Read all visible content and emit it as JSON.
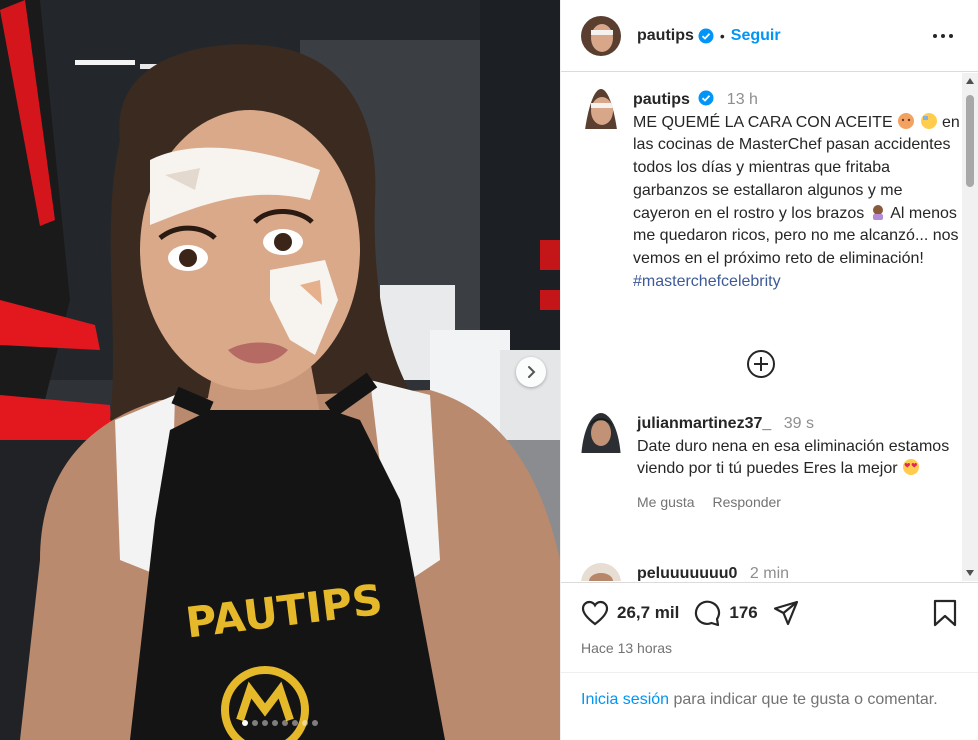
{
  "header": {
    "username": "pautips",
    "separator": "•",
    "follow_label": "Seguir"
  },
  "caption": {
    "username": "pautips",
    "time": "13 h",
    "text_line1": "ME QUEMÉ LA CARA CON ACEITE",
    "text_body": "en las cocinas de MasterChef pasan accidentes todos los días y mientras que fritaba garbanzos se estallaron algunos y me cayeron en el rostro y los brazos",
    "text_body2": "Al menos me quedaron ricos, pero no me alcanzó... nos vemos en el próximo reto de eliminación!",
    "hashtag": "#masterchefcelebrity"
  },
  "comments": [
    {
      "username": "julianmartinez37_",
      "time": "39 s",
      "text": "Date duro nena en esa eliminación estamos viendo por ti tú puedes Eres la mejor",
      "like_label": "Me gusta",
      "reply_label": "Responder"
    },
    {
      "username": "peluuuuuuu0",
      "time": "2 min"
    }
  ],
  "actions": {
    "likes": "26,7 mil",
    "comments": "176"
  },
  "timestamp": "Hace 13 horas",
  "login": {
    "link": "Inicia sesión",
    "rest": "para indicar que te gusta o comentar."
  },
  "media": {
    "apron_text": "PAUTIPS",
    "carousel_total": 8,
    "carousel_active": 1
  },
  "colors": {
    "link_blue": "#0095f6",
    "hashtag_blue": "#3d5a98",
    "muted": "#737373",
    "verified": "#0095f6"
  }
}
